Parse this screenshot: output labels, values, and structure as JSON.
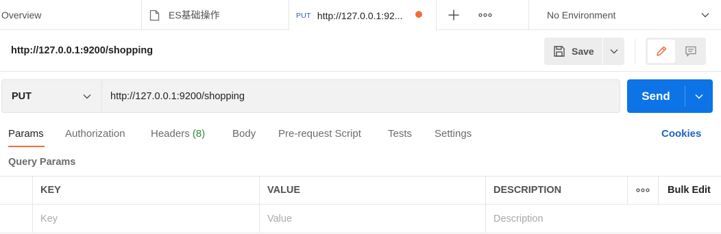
{
  "tabs": {
    "overview": "Overview",
    "collection_tab": "ES基础操作",
    "active_tab": {
      "method": "PUT",
      "title": "http://127.0.0.1:92..."
    }
  },
  "environment": {
    "selected": "No Environment"
  },
  "request": {
    "title": "http://127.0.0.1:9200/shopping",
    "method": "PUT",
    "url": "http://127.0.0.1:9200/shopping"
  },
  "actions": {
    "save_label": "Save",
    "send_label": "Send"
  },
  "request_tabs": {
    "params": "Params",
    "authorization": "Authorization",
    "headers": "Headers",
    "headers_count": "(8)",
    "body": "Body",
    "pre_request_script": "Pre-request Script",
    "tests": "Tests",
    "settings": "Settings",
    "cookies": "Cookies"
  },
  "query_params": {
    "label": "Query Params",
    "columns": {
      "key": "KEY",
      "value": "VALUE",
      "description": "DESCRIPTION",
      "bulk_edit": "Bulk Edit"
    },
    "placeholders": {
      "key": "Key",
      "value": "Value",
      "description": "Description"
    }
  },
  "colors": {
    "accent": "#f26b3a",
    "send": "#0c74e6",
    "cookies": "#1a63c9",
    "method_tag": "#2a5dba"
  },
  "icons": [
    "document-icon",
    "unsaved-dot-icon",
    "plus-icon",
    "more-dots-icon",
    "chevron-down-icon",
    "save-icon",
    "pencil-icon",
    "comment-icon"
  ]
}
